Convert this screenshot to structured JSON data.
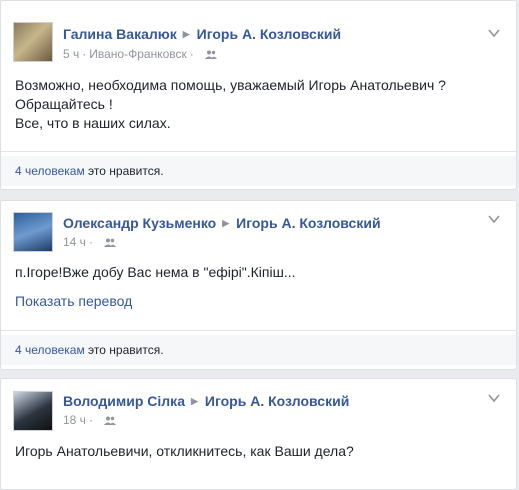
{
  "posts": [
    {
      "author": "Галина Вакалюк",
      "target": "Игорь А. Козловский",
      "time": "5 ч",
      "location": "Ивано-Франковск",
      "text_lines": [
        "Возможно, необходима помощь, уважаемый Игорь Анатольевич ?",
        "Обращайтесь !",
        "Все, что в наших силах."
      ],
      "likes_count": "4 человекам",
      "likes_suffix": "это нравится."
    },
    {
      "author": "Олександр Кузьменко",
      "target": "Игорь А. Козловский",
      "time": "14 ч",
      "text_lines": [
        "п.Ігоре!Вже добу Вас нема в \"ефірі\".Кіпіш..."
      ],
      "translate_label": "Показать перевод",
      "likes_count": "4 человекам",
      "likes_suffix": "это нравится."
    },
    {
      "author": "Володимир Сілка",
      "target": "Игорь А. Козловский",
      "time": "18 ч",
      "text_lines": [
        "Игорь Анатольевичи, откликнитесь, как Ваши дела?"
      ]
    }
  ],
  "icons": {
    "arrow": "right-triangle-icon",
    "audience": "friends-icon",
    "menu": "chevron-down-icon"
  },
  "colors": {
    "link": "#365899",
    "text": "#1d2129",
    "meta": "#90949c",
    "background": "#e9ebee"
  }
}
